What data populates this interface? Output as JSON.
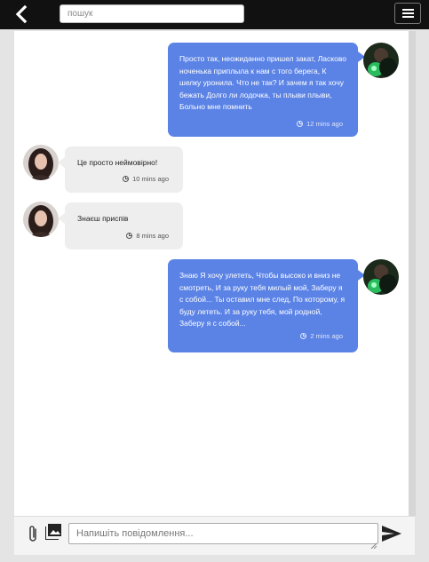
{
  "header": {
    "search_placeholder": "пошук",
    "back_icon": "arrow-left-icon",
    "menu_icon": "hamburger-icon"
  },
  "messages": [
    {
      "direction": "outgoing",
      "text": "Просто так, неожиданно пришел закат, Ласково ноченька приплыла к нам с того берега, К шелку уронила. Что не так? И зачем я так хочу бежать Долго ли лодочка, ты плыви плыви, Больно мне помнить",
      "time": "12 mins ago"
    },
    {
      "direction": "incoming",
      "text": "Це просто неймовірно!",
      "time": "10 mins ago"
    },
    {
      "direction": "incoming",
      "text": "Знаєш приспів",
      "time": "8 mins ago"
    },
    {
      "direction": "outgoing",
      "text": "Знаю Я хочу улететь, Чтобы высоко и вниз не смотреть, И за руку тебя милый мой, Заберу я с собой... Ты оставил мне след, По которому, я буду лететь. И за руку тебя, мой родной, Заберу я с собой...",
      "time": "2 mins ago"
    }
  ],
  "composer": {
    "placeholder": "Напишіть повідомлення...",
    "attach_icon": "paperclip-icon",
    "image_icon": "image-gallery-icon",
    "send_icon": "send-icon"
  },
  "colors": {
    "topbar": "#111111",
    "outgoing_bubble": "#5b83e6",
    "incoming_bubble": "#eeeeee",
    "page_background": "#e4e4e4"
  }
}
